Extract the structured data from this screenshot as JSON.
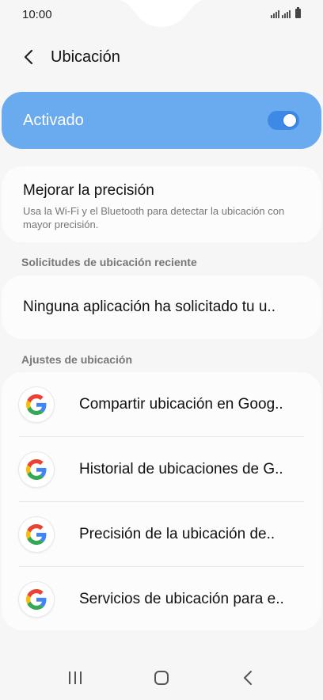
{
  "status_bar": {
    "time": "10:00"
  },
  "header": {
    "title": "Ubicación"
  },
  "master": {
    "label": "Activado",
    "enabled": true,
    "accent_color": "#6aaaee"
  },
  "accuracy": {
    "title": "Mejorar la precisión",
    "description": "Usa la Wi-Fi y el Bluetooth para detectar la ubicación con mayor precisión."
  },
  "recent": {
    "section_label": "Solicitudes de ubicación reciente",
    "empty_text": "Ninguna aplicación ha solicitado tu u.."
  },
  "settings": {
    "section_label": "Ajustes de ubicación",
    "items": [
      {
        "label": "Compartir ubicación en Goog..",
        "icon": "google-icon"
      },
      {
        "label": "Historial de ubicaciones de G..",
        "icon": "google-icon"
      },
      {
        "label": "Precisión de la ubicación de..",
        "icon": "google-icon"
      },
      {
        "label": "Servicios de ubicación para e..",
        "icon": "google-icon"
      }
    ]
  },
  "nav_bar": {
    "icons": [
      "recent-apps-icon",
      "home-icon",
      "back-icon"
    ]
  }
}
